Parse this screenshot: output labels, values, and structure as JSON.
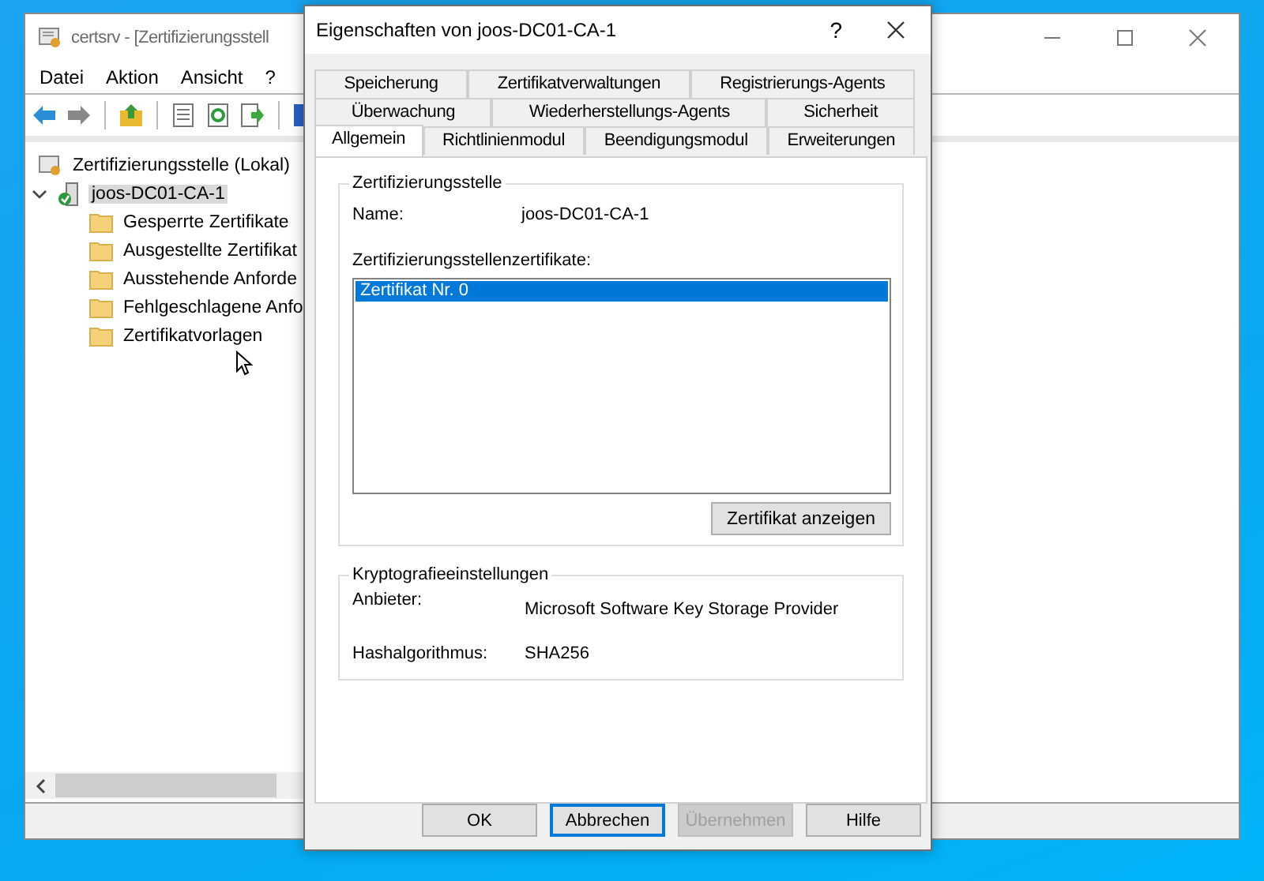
{
  "main_window": {
    "title": "certsrv - [Zertifizierungsstell",
    "menu": [
      "Datei",
      "Aktion",
      "Ansicht",
      "?"
    ],
    "tree": {
      "label": "Zertifizierungsstelle (Lokal)",
      "children": [
        {
          "label": "joos-DC01-CA-1",
          "expanded": true,
          "selected": true,
          "children": [
            {
              "label": "Gesperrte Zertifikate"
            },
            {
              "label": "Ausgestellte Zertifikat"
            },
            {
              "label": "Ausstehende Anforde"
            },
            {
              "label": "Fehlgeschlagene Anfo"
            },
            {
              "label": "Zertifikatvorlagen"
            }
          ]
        }
      ]
    }
  },
  "dialog": {
    "title": "Eigenschaften von joos-DC01-CA-1",
    "help": "?",
    "tab_rows": [
      [
        {
          "label": "Speicherung",
          "selected": false
        },
        {
          "label": "Zertifikatverwaltungen",
          "selected": false
        },
        {
          "label": "Registrierungs-Agents",
          "selected": false
        }
      ],
      [
        {
          "label": "Überwachung",
          "selected": false
        },
        {
          "label": "Wiederherstellungs-Agents",
          "selected": false
        },
        {
          "label": "Sicherheit",
          "selected": false
        }
      ],
      [
        {
          "label": "Allgemein",
          "selected": true
        },
        {
          "label": "Richtlinienmodul",
          "selected": false
        },
        {
          "label": "Beendigungsmodul",
          "selected": false
        },
        {
          "label": "Erweiterungen",
          "selected": false
        }
      ]
    ],
    "ca_group": {
      "title": "Zertifizierungsstelle",
      "name_label": "Name:",
      "name_value": "joos-DC01-CA-1",
      "list_label": "Zertifizierungsstellenzertifikate:",
      "list_items": [
        {
          "label": "Zertifikat Nr. 0",
          "selected": true
        }
      ],
      "view_button": "Zertifikat anzeigen"
    },
    "crypto_group": {
      "title": "Kryptografieeinstellungen",
      "fields": [
        {
          "label": "Anbieter:",
          "value": "Microsoft Software Key Storage Provider"
        },
        {
          "label": "Hashalgorithmus:",
          "value": "SHA256"
        }
      ]
    },
    "buttons": [
      {
        "label": "OK",
        "focused": false,
        "disabled": false
      },
      {
        "label": "Abbrechen",
        "focused": true,
        "disabled": false
      },
      {
        "label": "Übernehmen",
        "focused": false,
        "disabled": true
      },
      {
        "label": "Hilfe",
        "focused": false,
        "disabled": false
      }
    ]
  }
}
